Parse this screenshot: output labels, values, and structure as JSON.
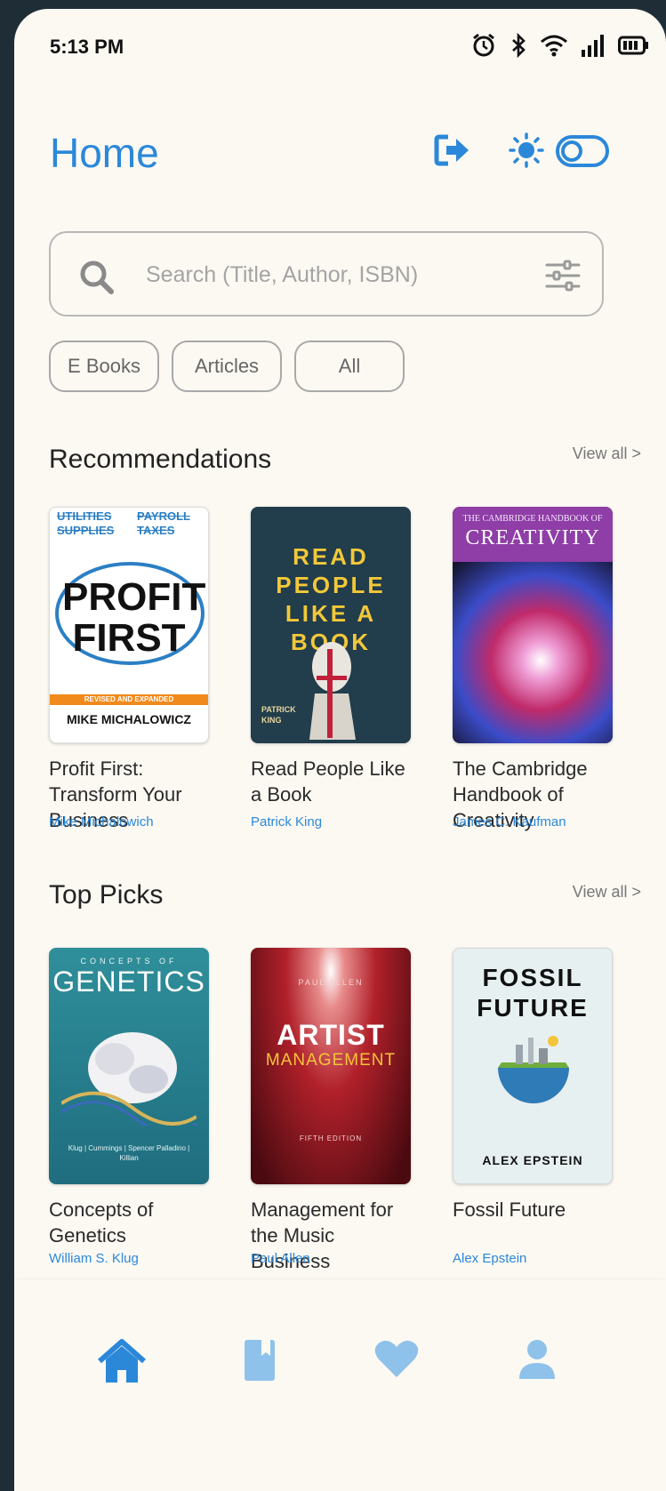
{
  "status_bar": {
    "time": "5:13 PM"
  },
  "header": {
    "title": "Home"
  },
  "search": {
    "placeholder": "Search (Title, Author, ISBN)"
  },
  "filters": [
    "E Books",
    "Articles",
    "All"
  ],
  "sections": [
    {
      "title": "Recommendations",
      "view_all": "View all >",
      "books": [
        {
          "title": "Profit First: Transform Your Business",
          "author": "Mike Michalowich",
          "cover": {
            "top_left": "UTILITIES SUPPLIES",
            "top_right": "PAYROLL TAXES",
            "main": "PROFIT FIRST",
            "band": "REVISED AND EXPANDED",
            "author": "MIKE MICHALOWICZ"
          }
        },
        {
          "title": "Read People Like a Book",
          "author": "Patrick King",
          "cover": {
            "main": "READ PEOPLE LIKE A BOOK",
            "author": "PATRICK KING"
          }
        },
        {
          "title": "The Cambridge Handbook of Creativity",
          "author": "James C. Kaufman",
          "cover": {
            "top": "THE CAMBRIDGE HANDBOOK OF",
            "main": "CREATIVITY"
          }
        }
      ]
    },
    {
      "title": "Top Picks",
      "view_all": "View all >",
      "books": [
        {
          "title": "Concepts of Genetics",
          "author": "William S. Klug",
          "cover": {
            "top": "CONCEPTS OF",
            "main": "GENETICS",
            "authors": "Klug | Cummings | Spencer Palladino | Killian"
          }
        },
        {
          "title": "Management for the Music Business",
          "author": "Paul Allen",
          "cover": {
            "top": "PAUL ALLEN",
            "main": "ARTIST",
            "sub": "MANAGEMENT",
            "edition": "FIFTH EDITION"
          }
        },
        {
          "title": "Fossil Future",
          "author": "Alex Epstein",
          "cover": {
            "main": "FOSSIL FUTURE",
            "author": "ALEX EPSTEIN"
          }
        }
      ]
    }
  ],
  "nav": [
    "home-icon",
    "book-icon",
    "heart-icon",
    "profile-icon"
  ],
  "colors": {
    "accent": "#2b88d9",
    "background": "#fcf9f3",
    "frame": "#1f2d36"
  }
}
